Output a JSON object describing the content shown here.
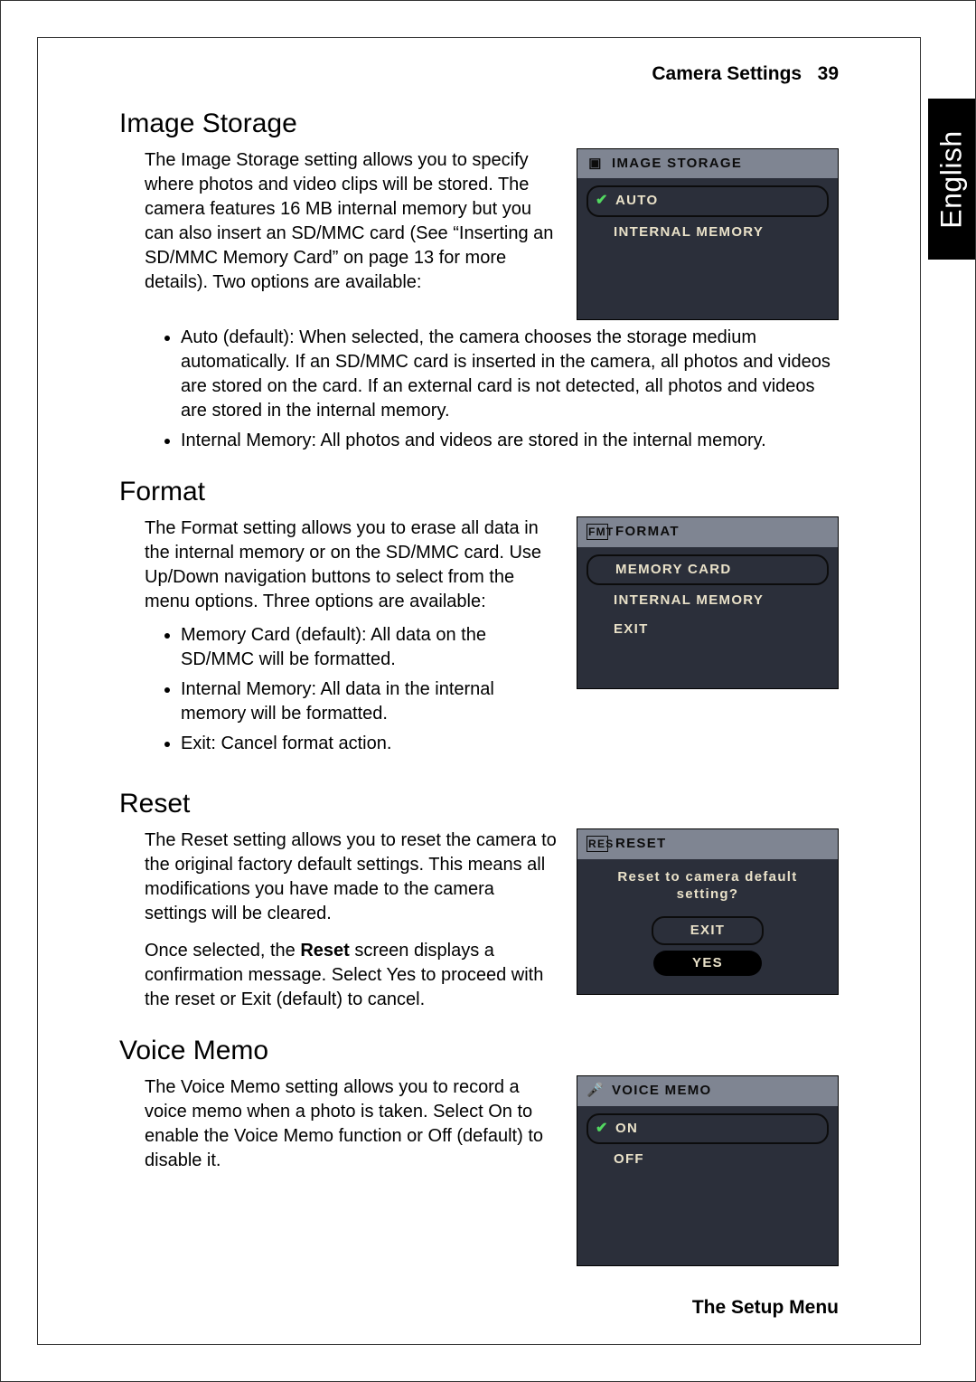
{
  "header": {
    "title": "Camera Settings",
    "page_no": "39"
  },
  "lang_tab": "English",
  "footer": "The Setup Menu",
  "image_storage": {
    "heading": "Image Storage",
    "intro": "The Image Storage  setting allows you to specify where photos and video clips will be stored. The camera features 16 MB internal memory but you can also insert an SD/MMC card (See “Inserting an SD/MMC Memory Card” on page 13 for more details). Two options are available:",
    "bullets": [
      "Auto (default): When selected, the camera chooses the storage medium automatically. If an SD/MMC card is inserted in the camera, all photos and videos are stored on the card. If an external card is not detected, all photos and videos are stored in the internal memory.",
      "Internal Memory: All photos and videos are stored in the internal memory."
    ],
    "menu": {
      "title": "IMAGE STORAGE",
      "options": [
        {
          "label": "AUTO",
          "selected": true,
          "checked": true
        },
        {
          "label": "INTERNAL MEMORY",
          "selected": false,
          "checked": false
        }
      ]
    }
  },
  "format": {
    "heading": "Format",
    "intro": "The Format  setting allows you to erase all data in the internal memory or on the SD/MMC card. Use Up/Down  navigation buttons to select from the menu options. Three options are available:",
    "bullets": [
      "Memory Card (default): All data on the SD/MMC will be formatted.",
      "Internal Memory: All data in the internal memory will be formatted.",
      "Exit: Cancel format action."
    ],
    "menu": {
      "title": "FORMAT",
      "options": [
        {
          "label": "MEMORY CARD",
          "selected": true,
          "checked": false
        },
        {
          "label": "INTERNAL MEMORY",
          "selected": false,
          "checked": false
        },
        {
          "label": "EXIT",
          "selected": false,
          "checked": false
        }
      ]
    }
  },
  "reset": {
    "heading": "Reset",
    "intro1": "The Reset setting allows you to reset the camera to the original factory default settings. This means all modifications you have made to the camera settings will be cleared.",
    "intro2_pre": "Once selected, the ",
    "intro2_bold": "Reset",
    "intro2_post": " screen displays a confirmation message. Select Yes to proceed with the reset or Exit (default) to cancel.",
    "menu": {
      "title": "RESET",
      "prompt": "Reset to camera default setting?",
      "buttons": [
        {
          "label": "EXIT",
          "selected": true,
          "yes": false
        },
        {
          "label": "YES",
          "selected": false,
          "yes": true
        }
      ]
    }
  },
  "voice_memo": {
    "heading": "Voice Memo",
    "intro": "The Voice Memo setting allows you to record a voice memo when a photo is taken. Select On to enable the Voice Memo function or Off (default) to disable it.",
    "menu": {
      "title": "VOICE MEMO",
      "options": [
        {
          "label": "ON",
          "selected": true,
          "checked": true
        },
        {
          "label": "OFF",
          "selected": false,
          "checked": false
        }
      ]
    }
  }
}
